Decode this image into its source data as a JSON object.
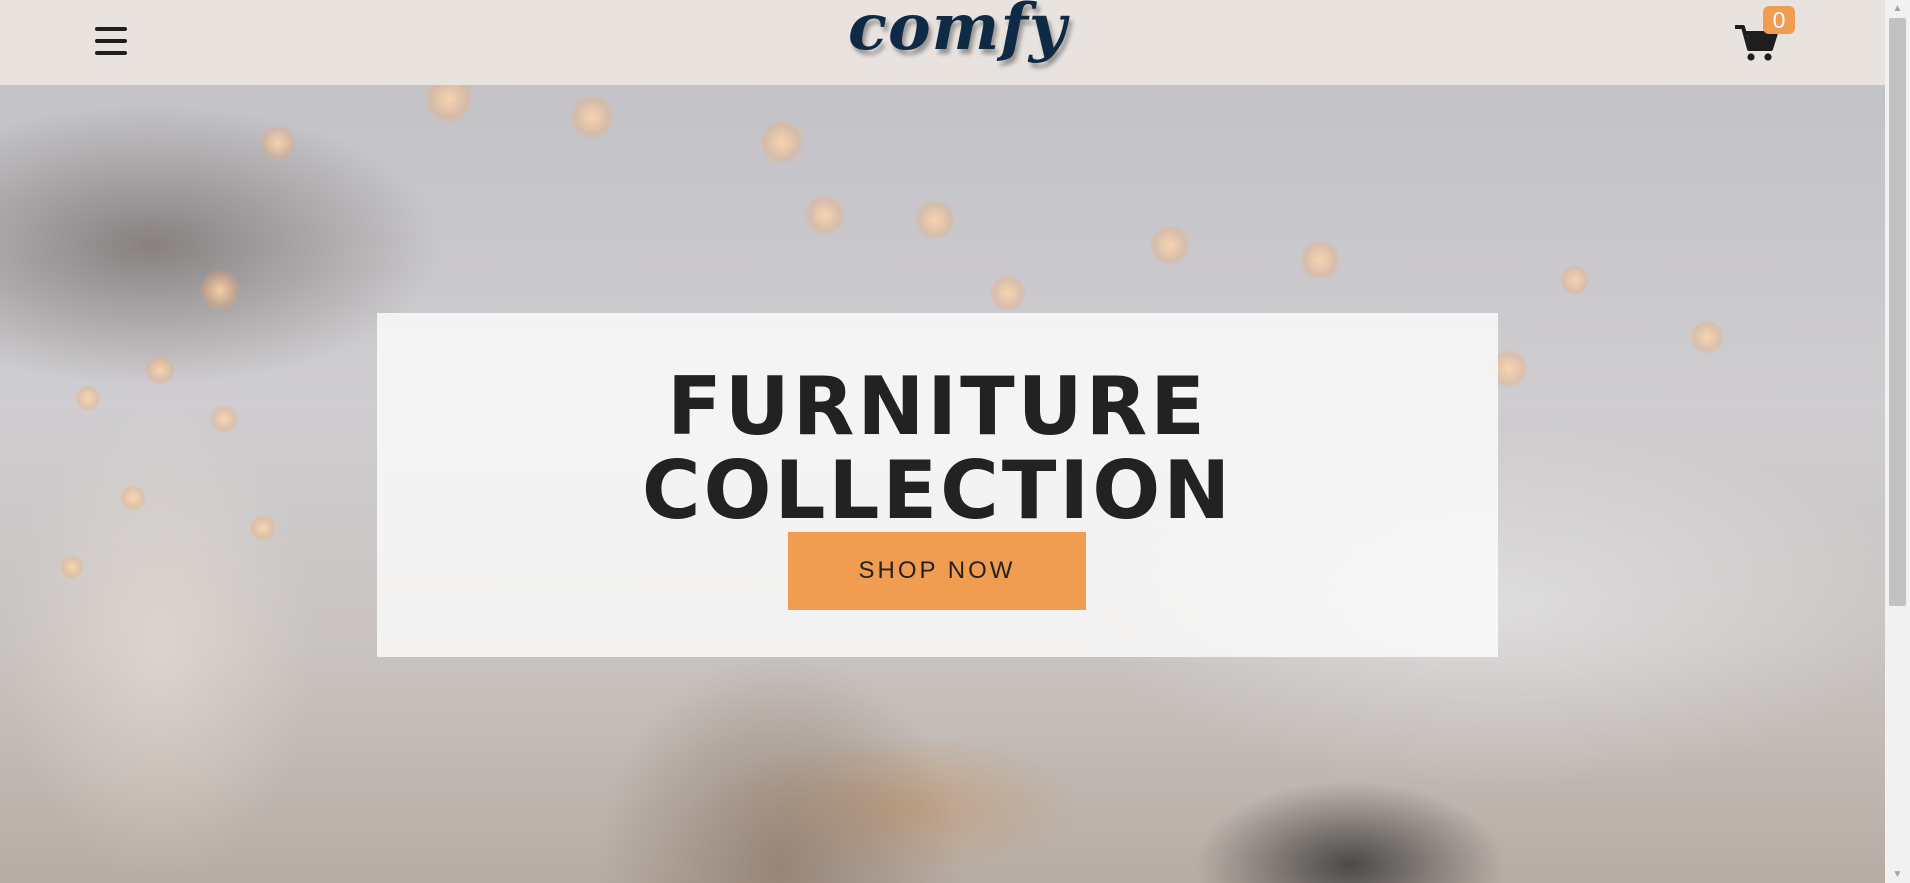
{
  "brand": {
    "logo_text": "comfy",
    "logo_color": "#0f2a44"
  },
  "navbar": {
    "menu_icon": "hamburger-menu-icon",
    "cart_icon": "cart-icon",
    "cart_count": "0",
    "background": "#e8e3df"
  },
  "hero": {
    "title": "FURNITURE COLLECTION",
    "button_label": "SHOP NOW",
    "accent_color": "#f09d51"
  },
  "scrollbar": {
    "up_arrow": "▲",
    "down_arrow": "▼"
  }
}
